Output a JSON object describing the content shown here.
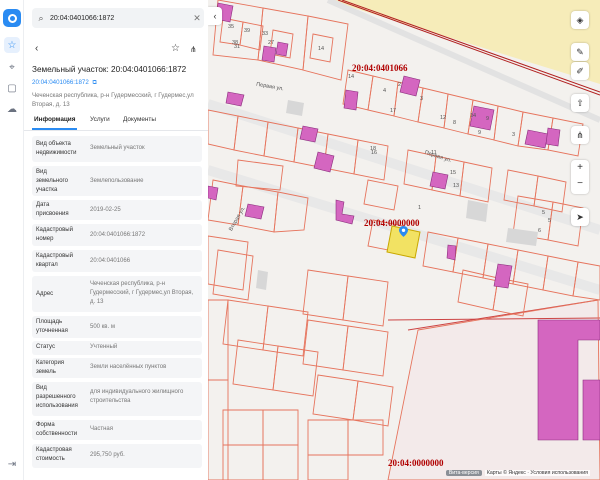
{
  "search": {
    "value": "20:04:0401066:1872"
  },
  "panel": {
    "title": "Земельный участок: 20:04:0401066:1872",
    "cad_link": "20:04:0401066:1872",
    "address": "Чеченская республика, р-н Гудермесский, г Гудермес,ул Вторая, д. 13",
    "tabs": [
      "Информация",
      "Услуги",
      "Документы"
    ],
    "rows": [
      {
        "k": "Вид объекта недвижимости",
        "v": "Земельный участок"
      },
      {
        "k": "Вид земельного участка",
        "v": "Землепользование"
      },
      {
        "k": "Дата присвоения",
        "v": "2019-02-25"
      },
      {
        "k": "Кадастровый номер",
        "v": "20:04:0401066:1872"
      },
      {
        "k": "Кадастровый квартал",
        "v": "20:04:0401066"
      },
      {
        "k": "Адрес",
        "v": "Чеченская республика, р-н Гудермесский, г Гудермес,ул Вторая, д. 13"
      },
      {
        "k": "Площадь уточненная",
        "v": "500 кв. м"
      },
      {
        "k": "Статус",
        "v": "Учтенный"
      },
      {
        "k": "Категория земель",
        "v": "Земли населённых пунктов"
      },
      {
        "k": "Вид разрешенного использования",
        "v": "для индивидуального жилищного строительства"
      },
      {
        "k": "Форма собственности",
        "v": "Частная"
      },
      {
        "k": "Кадастровая стоимость",
        "v": "295,750 руб."
      }
    ]
  },
  "map": {
    "labels": [
      "20:04:0401066",
      "20:04:0000000",
      "20:04:0000000"
    ],
    "streets": [
      "Первая ул.",
      "Первая ул.",
      "Вторая ул."
    ],
    "lot_numbers": [
      "31",
      "35",
      "39",
      "38",
      "27",
      "33",
      "14",
      "11",
      "15",
      "13",
      "16",
      "14",
      "9",
      "3",
      "7",
      "6",
      "8",
      "12",
      "9",
      "5",
      "4",
      "18",
      "10",
      "11",
      "19",
      "17",
      "14",
      "3",
      "2",
      "5",
      "1"
    ],
    "attribution_tag": "Вита-версия",
    "attribution": "Карты © Яндекс · Условия использования",
    "zoom_in": "+",
    "zoom_out": "−"
  },
  "colors": {
    "accent": "#2a8bf2",
    "parcel": "#e6745d",
    "building": "#d466c0",
    "selected": "#f2e263"
  }
}
